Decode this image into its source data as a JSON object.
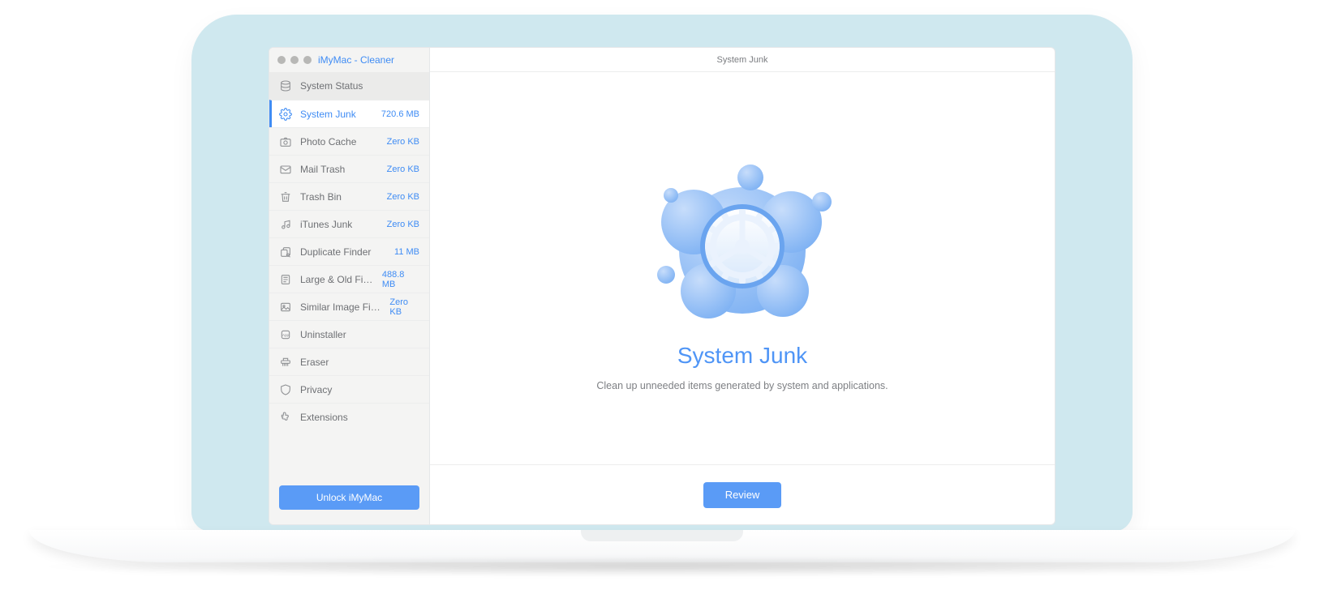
{
  "app": {
    "title": "iMyMac - Cleaner"
  },
  "sidebar": {
    "items": [
      {
        "id": "system-status",
        "label": "System Status",
        "value": ""
      },
      {
        "id": "system-junk",
        "label": "System Junk",
        "value": "720.6 MB"
      },
      {
        "id": "photo-cache",
        "label": "Photo Cache",
        "value": "Zero KB"
      },
      {
        "id": "mail-trash",
        "label": "Mail Trash",
        "value": "Zero KB"
      },
      {
        "id": "trash-bin",
        "label": "Trash Bin",
        "value": "Zero KB"
      },
      {
        "id": "itunes-junk",
        "label": "iTunes Junk",
        "value": "Zero KB"
      },
      {
        "id": "duplicate",
        "label": "Duplicate Finder",
        "value": "11 MB"
      },
      {
        "id": "large-old",
        "label": "Large & Old Files",
        "value": "488.8 MB"
      },
      {
        "id": "sim-image",
        "label": "Similar Image Finder",
        "value": "Zero KB"
      },
      {
        "id": "uninstaller",
        "label": "Uninstaller",
        "value": ""
      },
      {
        "id": "eraser",
        "label": "Eraser",
        "value": ""
      },
      {
        "id": "privacy",
        "label": "Privacy",
        "value": ""
      },
      {
        "id": "extensions",
        "label": "Extensions",
        "value": ""
      }
    ],
    "unlock_label": "Unlock iMyMac"
  },
  "main": {
    "header": "System Junk",
    "title": "System Junk",
    "subtitle": "Clean up unneeded items generated by system and applications.",
    "review_label": "Review"
  },
  "colors": {
    "accent": "#5a9bf6"
  }
}
